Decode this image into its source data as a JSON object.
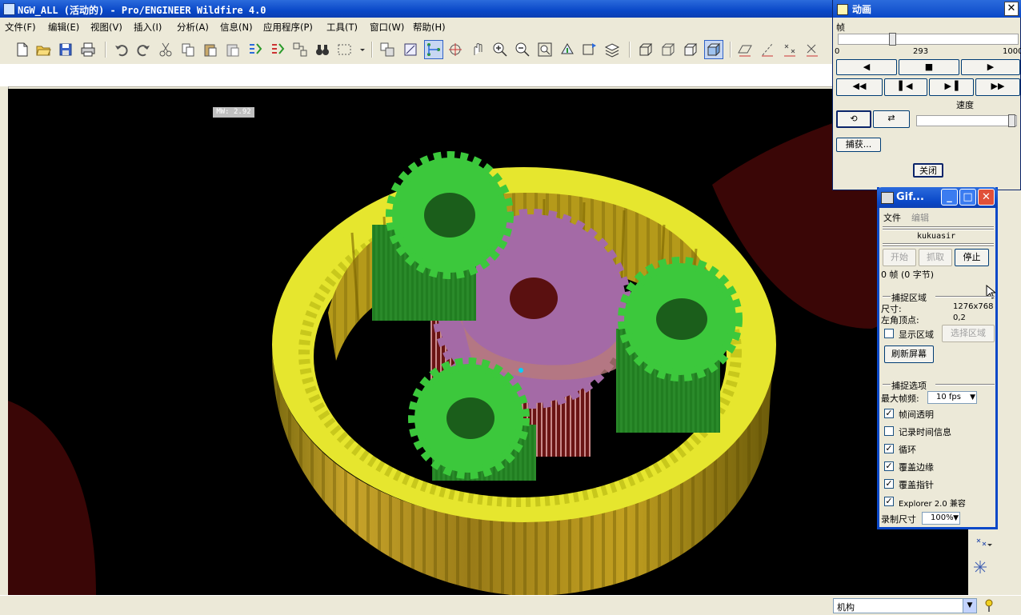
{
  "window": {
    "title": "NGW_ALL (活动的) - Pro/ENGINEER Wildfire 4.0"
  },
  "menubar": [
    "文件(F)",
    "编辑(E)",
    "视图(V)",
    "插入(I)",
    "分析(A)",
    "信息(N)",
    "应用程序(P)",
    "工具(T)",
    "窗口(W)",
    "帮助(H)"
  ],
  "viewport": {
    "scale_tag": "MW: 2.92"
  },
  "animation": {
    "title": "动画",
    "frame_label": "帧",
    "slider_min": "0",
    "slider_current": "293",
    "slider_max": "1000",
    "frame_fraction": 0.293,
    "speed_label": "速度",
    "capture_button": "捕获...",
    "close_button": "关闭"
  },
  "gif": {
    "title": "Gif...",
    "menu_file": "文件",
    "menu_edit": "编辑",
    "brand": "kukuasir",
    "start_button": "开始",
    "grab_button": "抓取",
    "stop_button": "停止",
    "frames_info": "0 帧 (0 字节)",
    "capture_area_header": "捕捉区域",
    "size_label": "尺寸:",
    "size_value": "1276x768",
    "origin_label": "左角顶点:",
    "origin_value": "0,2",
    "show_area_label": "显示区域",
    "select_area_button": "选择区域",
    "refresh_button": "刷新屏幕",
    "capture_options_header": "捕捉选项",
    "max_fps_label": "最大帧频:",
    "max_fps_value": "10 fps",
    "options": [
      {
        "label": "帧间透明",
        "checked": true
      },
      {
        "label": "记录时间信息",
        "checked": false
      },
      {
        "label": "循环",
        "checked": true
      },
      {
        "label": "覆盖边缘",
        "checked": true
      },
      {
        "label": "覆盖指针",
        "checked": true
      },
      {
        "label": "Explorer 2.0 兼容",
        "checked": true
      }
    ],
    "record_size_label": "录制尺寸",
    "record_size_value": "100%"
  },
  "status": {
    "mechanism_select": "机构"
  },
  "colors": {
    "ring_gear": "#e6e62e",
    "planet_gear": "#3cc83c",
    "sun_gear": "#a46aa6",
    "titlebar": "#0a48c8"
  }
}
